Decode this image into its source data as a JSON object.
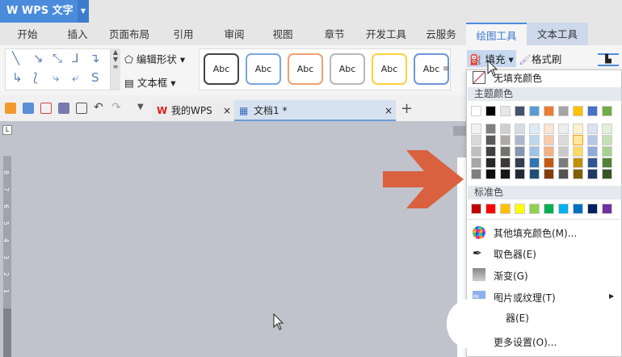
{
  "app": {
    "title": "WPS 文字",
    "dropdown_icon": "caret-down-icon"
  },
  "tabs": [
    "开始",
    "插入",
    "页面布局",
    "引用",
    "审阅",
    "视图",
    "章节",
    "开发工具",
    "云服务",
    "绘图工具",
    "文本工具"
  ],
  "active_tab": "绘图工具",
  "ribbon": {
    "edit_shape": "编辑形状",
    "textbox": "文本框",
    "style_label": "Abc",
    "fill": "填充",
    "format_painter": "格式刷",
    "style_borders": [
      "#444444",
      "#7aa7dd",
      "#f0a070",
      "#b8b8b8",
      "#ffd040",
      "#6f95d8"
    ]
  },
  "quickbar": {
    "doc_tabs": [
      {
        "label": "我的WPS"
      },
      {
        "label": "文档1 *"
      }
    ],
    "new_tab": "+",
    "close": "×"
  },
  "ruler": {
    "labels": [
      "8",
      "7",
      "6",
      "5",
      "4",
      "3",
      "2",
      "1",
      "1",
      "2"
    ]
  },
  "fill_menu": {
    "no_fill": "无填充颜色",
    "theme_header": "主题颜色",
    "theme_colors": [
      "#ffffff",
      "#000000",
      "#e7e6e6",
      "#44546a",
      "#5b9bd5",
      "#ed7d31",
      "#a5a5a5",
      "#ffc000",
      "#4472c4",
      "#70ad47"
    ],
    "shades": [
      [
        "#f2f2f2",
        "#d9d9d9",
        "#bfbfbf",
        "#a6a6a6",
        "#808080"
      ],
      [
        "#7f7f7f",
        "#595959",
        "#404040",
        "#262626",
        "#0d0d0d"
      ],
      [
        "#d0cece",
        "#aeaaaa",
        "#757171",
        "#3a3838",
        "#171616"
      ],
      [
        "#d6dce4",
        "#adb9ca",
        "#8496b0",
        "#333f4f",
        "#222a35"
      ],
      [
        "#deebf6",
        "#bdd7ee",
        "#9dc3e6",
        "#2e75b5",
        "#1f4e79"
      ],
      [
        "#fbe5d5",
        "#f8cbad",
        "#f4b183",
        "#c55a11",
        "#843c0b"
      ],
      [
        "#ededed",
        "#dbdbdb",
        "#c9c9c9",
        "#7b7b7b",
        "#525252"
      ],
      [
        "#fff2cc",
        "#ffe699",
        "#ffd966",
        "#bf9000",
        "#7f6000"
      ],
      [
        "#dae3f3",
        "#b4c7e7",
        "#8faadc",
        "#2f5597",
        "#203864"
      ],
      [
        "#e2f0d9",
        "#c5e0b4",
        "#a9d18e",
        "#538135",
        "#375623"
      ]
    ],
    "selected": "#ffe699",
    "standard_header": "标准色",
    "standard_colors": [
      "#c00000",
      "#ff0000",
      "#ffc000",
      "#ffff00",
      "#92d050",
      "#00b050",
      "#00b0f0",
      "#0070c0",
      "#002060",
      "#7030a0"
    ],
    "items": [
      "其他填充颜色(M)...",
      "取色器(E)",
      "渐变(G)",
      "图片或纹理(T)",
      "器(E)",
      "更多设置(O)..."
    ]
  },
  "annotation_arrow_color": "#d9613f"
}
